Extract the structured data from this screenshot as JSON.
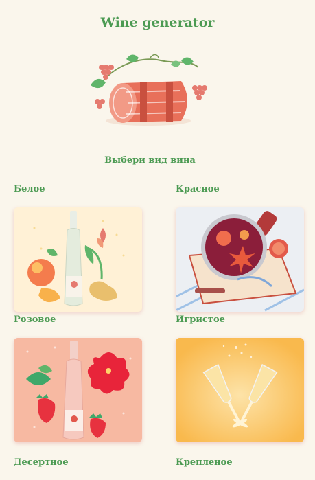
{
  "header": {
    "title": "Wine generator"
  },
  "subtitle": "Выбери вид вина",
  "categories": [
    {
      "label": "Белое"
    },
    {
      "label": "Красное"
    },
    {
      "label": "Розовое"
    },
    {
      "label": "Игристое"
    },
    {
      "label": "Десертное"
    },
    {
      "label": "Крепленое"
    }
  ],
  "colors": {
    "accent_green": "#4b9a52",
    "background": "#faf6ec",
    "barrel": "#e8705a"
  }
}
